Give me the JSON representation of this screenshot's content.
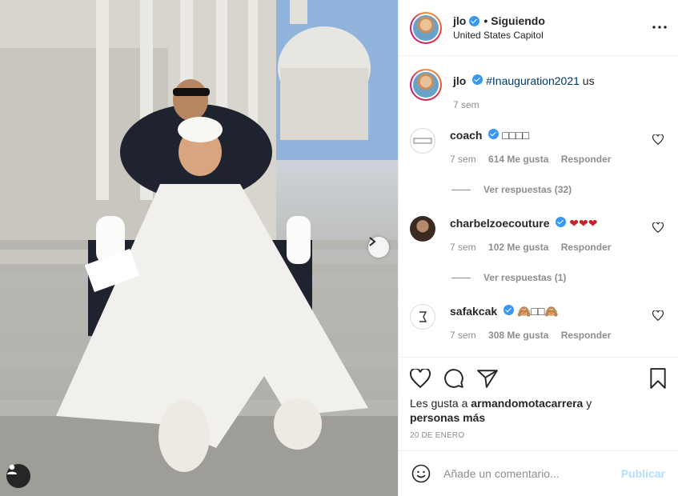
{
  "post": {
    "image_alt": "",
    "author": "jlo",
    "follow_separator": "•",
    "follow_status": "Siguiendo",
    "location": "United States Capitol",
    "more_icon": "more-horizontal-icon"
  },
  "caption": {
    "user": "jlo",
    "hashtag": "#Inauguration2021",
    "flag": "us",
    "time": "7 sem"
  },
  "comments": [
    {
      "user": "coach",
      "text": "□□□□",
      "time": "7 sem",
      "likes": "614 Me gusta",
      "reply": "Responder",
      "replies": "Ver respuestas (32)"
    },
    {
      "user": "charbelzoecouture",
      "text": "❤❤❤",
      "time": "7 sem",
      "likes": "102 Me gusta",
      "reply": "Responder",
      "replies": "Ver respuestas (1)"
    },
    {
      "user": "safakcak",
      "text": "🙈□□🙈",
      "time": "7 sem",
      "likes": "308 Me gusta",
      "reply": "Responder"
    }
  ],
  "likes": {
    "prefix": "Les gusta a ",
    "user": "armandomotacarrera",
    "middle": " y",
    "others": "personas más"
  },
  "date": "20 DE ENERO",
  "composer": {
    "placeholder": "Añade un comentario...",
    "submit": "Publicar"
  },
  "colors": {
    "verified": "#3897f0",
    "link": "#00376b",
    "muted": "#8e8e8e",
    "publish_disabled": "#b2dffc",
    "heart": "#ed4956"
  }
}
